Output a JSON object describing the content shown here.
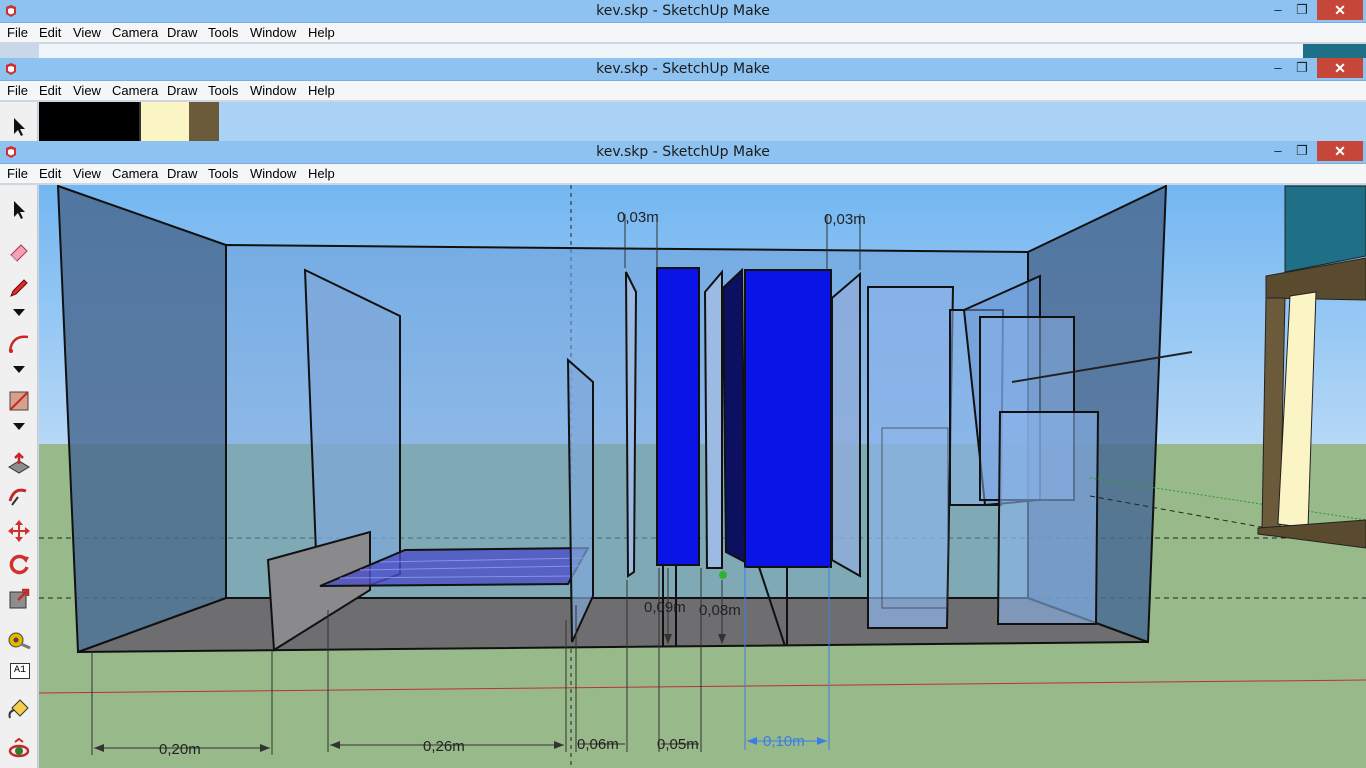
{
  "windows": [
    {
      "title": "kev.skp - SketchUp Make"
    },
    {
      "title": "kev.skp - SketchUp Make"
    },
    {
      "title": "kev.skp - SketchUp Make"
    }
  ],
  "menu": {
    "file": "File",
    "edit": "Edit",
    "view": "View",
    "camera": "Camera",
    "draw": "Draw",
    "tools": "Tools",
    "window": "Window",
    "help": "Help"
  },
  "window_controls": {
    "minimize": "–",
    "restore": "❐",
    "close": "✕"
  },
  "toolbar": {
    "tools": [
      {
        "name": "select-icon"
      },
      {
        "name": "eraser-icon"
      },
      {
        "name": "pencil-icon"
      },
      {
        "name": "dropdown-arrow-icon"
      },
      {
        "name": "arc-icon"
      },
      {
        "name": "dropdown-arrow-icon"
      },
      {
        "name": "rectangle-icon"
      },
      {
        "name": "dropdown-arrow-icon"
      },
      {
        "name": "push-pull-icon"
      },
      {
        "name": "follow-me-icon"
      },
      {
        "name": "move-icon"
      },
      {
        "name": "rotate-icon"
      },
      {
        "name": "scale-icon"
      },
      {
        "name": "tape-measure-icon"
      },
      {
        "name": "text-label-icon"
      },
      {
        "name": "paint-bucket-icon"
      },
      {
        "name": "orbit-icon"
      }
    ],
    "text_tool_label": "A1"
  },
  "dimensions": {
    "d020": "0,20m",
    "d026": "0,26m",
    "d006": "0,06m",
    "d005": "0,05m",
    "d010": "0,10m",
    "d009a": "0,09m",
    "d008": "0,08m",
    "top_left": "0,03m",
    "top_right": "0,03m"
  },
  "colors": {
    "sky": "#78b8f0",
    "ground": "#97b98a",
    "panel_blue": "#0a14e6",
    "glass": "#6a96d4",
    "floor": "#6e6e70"
  }
}
